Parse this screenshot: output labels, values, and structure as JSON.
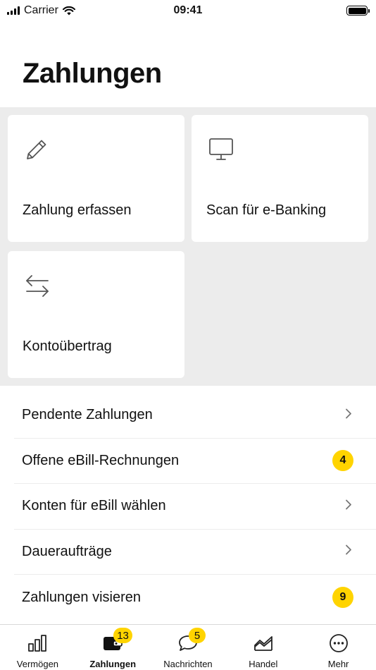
{
  "status_bar": {
    "carrier": "Carrier",
    "time": "09:41",
    "icons": [
      "signal-icon",
      "wifi-icon",
      "battery-icon"
    ]
  },
  "header": {
    "title": "Zahlungen"
  },
  "tiles": [
    {
      "label": "Zahlung erfassen",
      "icon": "pencil-icon"
    },
    {
      "label": "Scan für e-Banking",
      "icon": "monitor-icon"
    },
    {
      "label": "Kontoübertrag",
      "icon": "transfer-arrows-icon"
    }
  ],
  "list": [
    {
      "label": "Pendente Zahlungen",
      "accessory": "chevron"
    },
    {
      "label": "Offene eBill-Rechnungen",
      "accessory": "badge",
      "badge": "4"
    },
    {
      "label": "Konten für eBill wählen",
      "accessory": "chevron"
    },
    {
      "label": "Daueraufträge",
      "accessory": "chevron"
    },
    {
      "label": "Zahlungen visieren",
      "accessory": "badge",
      "badge": "9"
    }
  ],
  "tab_bar": {
    "tabs": [
      {
        "label": "Vermögen",
        "icon": "bar-chart-icon",
        "active": false
      },
      {
        "label": "Zahlungen",
        "icon": "wallet-icon",
        "active": true,
        "badge": "13"
      },
      {
        "label": "Nachrichten",
        "icon": "chat-bubble-icon",
        "active": false,
        "badge": "5"
      },
      {
        "label": "Handel",
        "icon": "trading-chart-icon",
        "active": false
      },
      {
        "label": "Mehr",
        "icon": "more-dots-icon",
        "active": false
      }
    ]
  },
  "colors": {
    "accent": "#ffd400",
    "tile_background": "#ececec",
    "text": "#111111"
  }
}
